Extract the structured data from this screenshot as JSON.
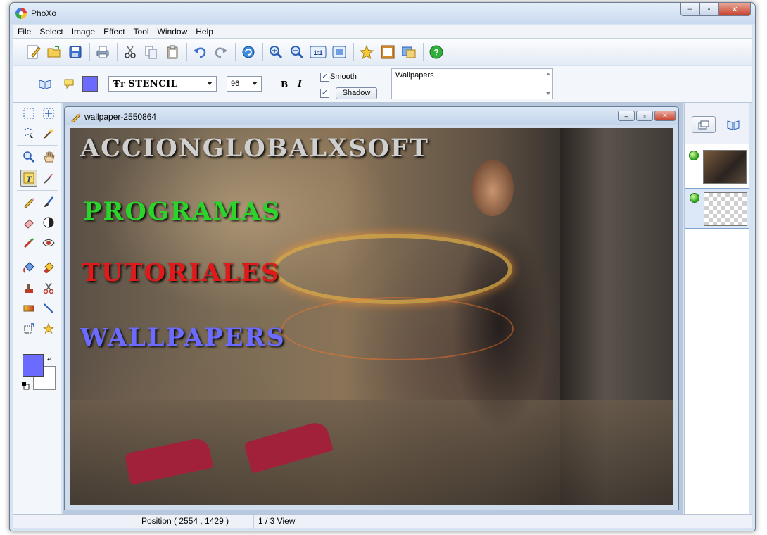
{
  "app": {
    "title": "PhoXo"
  },
  "caption_buttons": {
    "minimize": "–",
    "maximize": "▫",
    "close": "✕"
  },
  "menu": [
    "File",
    "Select",
    "Image",
    "Effect",
    "Tool",
    "Window",
    "Help"
  ],
  "toolbar_icons": [
    "new-icon",
    "open-icon",
    "save-icon",
    "print-icon",
    "cut-icon",
    "copy-icon",
    "paste-icon",
    "undo-icon",
    "redo-icon",
    "refresh-icon",
    "zoom-in-icon",
    "zoom-out-icon",
    "actual-size-icon",
    "fit-window-icon",
    "favorite-icon",
    "frame-icon",
    "screen-capture-icon",
    "help-icon"
  ],
  "text_options": {
    "text_color": "#6b6bff",
    "font_name": "STENCIL",
    "font_size": "96",
    "bold_label": "B",
    "italic_label": "I",
    "smooth_label": "Smooth",
    "smooth_checked": true,
    "shadow_checked": true,
    "shadow_label": "Shadow",
    "text_value": "Wallpapers"
  },
  "document": {
    "title": "wallpaper-2550864",
    "canvas_texts": [
      {
        "text": "ACCIONGLOBALXSOFT",
        "color": "#cfcfcf"
      },
      {
        "text": "PROGRAMAS",
        "color": "#2bd32b"
      },
      {
        "text": "TUTORIALES",
        "color": "#e01a1a"
      },
      {
        "text": "WALLPAPERS",
        "color": "#6b6bff"
      }
    ]
  },
  "palette": {
    "foreground": "#6b6bff",
    "background": "#ffffff"
  },
  "layers": [
    {
      "kind": "photo",
      "visible": true,
      "selected": false
    },
    {
      "kind": "text",
      "visible": true,
      "selected": true
    }
  ],
  "status": {
    "position": "Position ( 2554 , 1429 )",
    "view": "1 / 3 View"
  }
}
